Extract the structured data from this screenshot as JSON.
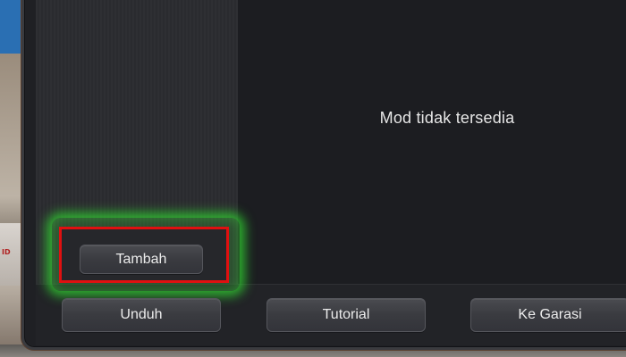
{
  "main": {
    "empty_message": "Mod tidak tersedia"
  },
  "sidebar": {
    "add_button_label": "Tambah"
  },
  "toolbar": {
    "download_label": "Unduh",
    "tutorial_label": "Tutorial",
    "garage_label": "Ke Garasi"
  },
  "background": {
    "sign_text": "ID"
  },
  "colors": {
    "highlight_border": "#e01010",
    "highlight_glow": "#32dc32",
    "panel_bg": "#1f2024",
    "sidebar_bg": "#2b2c30"
  }
}
